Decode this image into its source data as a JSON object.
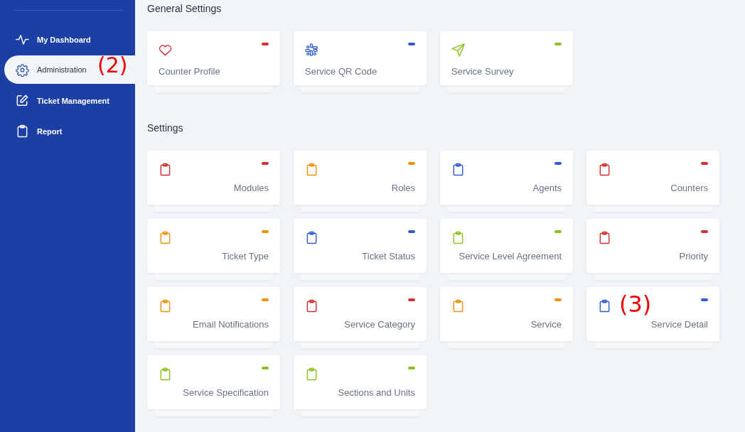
{
  "sidebar": {
    "items": [
      {
        "label": "My Dashboard",
        "selected": false
      },
      {
        "label": "Administration",
        "selected": true,
        "annotation": "(2)"
      },
      {
        "label": "Ticket Management",
        "selected": false
      },
      {
        "label": "Report",
        "selected": false
      }
    ]
  },
  "sections": [
    {
      "title": "General Settings",
      "kind": "general",
      "cards": [
        {
          "label": "Counter Profile",
          "color": "#d32f2f"
        },
        {
          "label": "Service QR Code",
          "color": "#2f5bd3"
        },
        {
          "label": "Service Survey",
          "color": "#8cc21d"
        }
      ]
    },
    {
      "title": "Settings",
      "kind": "settings",
      "cards": [
        {
          "label": "Modules",
          "color": "#d32f2f"
        },
        {
          "label": "Roles",
          "color": "#f0920a"
        },
        {
          "label": "Agents",
          "color": "#2f5bd3"
        },
        {
          "label": "Counters",
          "color": "#d32f2f"
        },
        {
          "label": "Ticket Type",
          "color": "#f0920a"
        },
        {
          "label": "Ticket Status",
          "color": "#2f5bd3"
        },
        {
          "label": "Service Level Agreement",
          "color": "#8cc21d"
        },
        {
          "label": "Priority",
          "color": "#d32f2f"
        },
        {
          "label": "Email Notifications",
          "color": "#f0920a"
        },
        {
          "label": "Service Category",
          "color": "#d32f2f"
        },
        {
          "label": "Service",
          "color": "#f0920a"
        },
        {
          "label": "Service Detail",
          "color": "#2f5bd3",
          "annotation": "(3)"
        },
        {
          "label": "Service Specification",
          "color": "#8cc21d"
        },
        {
          "label": "Sections and Units",
          "color": "#8cc21d"
        }
      ]
    }
  ]
}
